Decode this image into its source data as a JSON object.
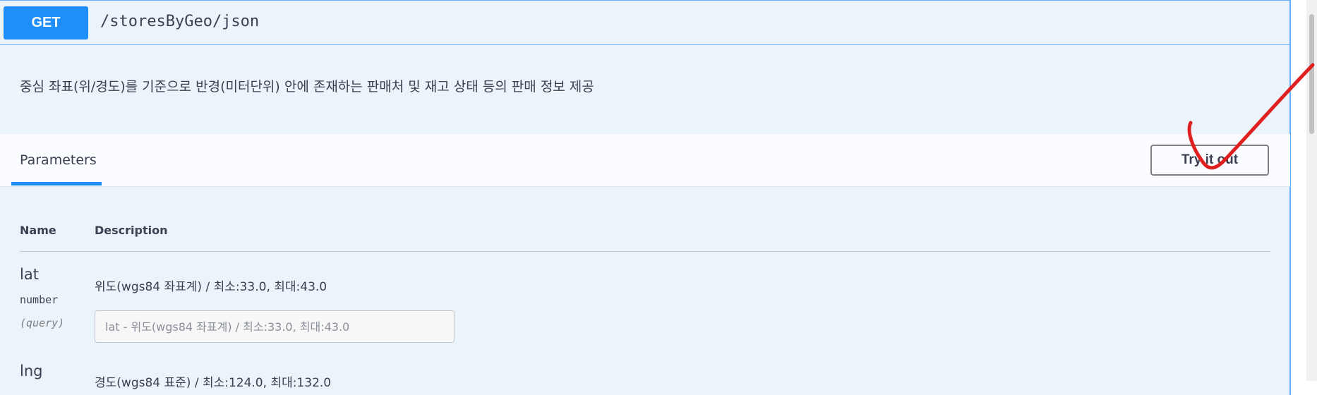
{
  "operation": {
    "method": "GET",
    "path": "/storesByGeo/json",
    "description": "중심 좌표(위/경도)를 기준으로 반경(미터단위) 안에 존재하는 판매처 및 재고 상태 등의 판매 정보 제공"
  },
  "section": {
    "tab_label": "Parameters",
    "try_button_label": "Try it out"
  },
  "table": {
    "headers": {
      "name": "Name",
      "description": "Description"
    },
    "params": [
      {
        "name": "lat",
        "type": "number",
        "in": "(query)",
        "description": "위도(wgs84 좌표계) / 최소:33.0, 최대:43.0",
        "placeholder": "lat - 위도(wgs84 좌표계) / 최소:33.0, 최대:43.0",
        "value": ""
      },
      {
        "name": "lng",
        "description": "경도(wgs84 표준) / 최소:124.0, 최대:132.0"
      }
    ]
  },
  "colors": {
    "accent": "#61affe",
    "method_bg": "#1f8ef9",
    "block_bg": "#ebf3fb",
    "annotation": "#e02020"
  },
  "icons": {
    "annotation_mark": "checkmark-annotation-icon"
  }
}
